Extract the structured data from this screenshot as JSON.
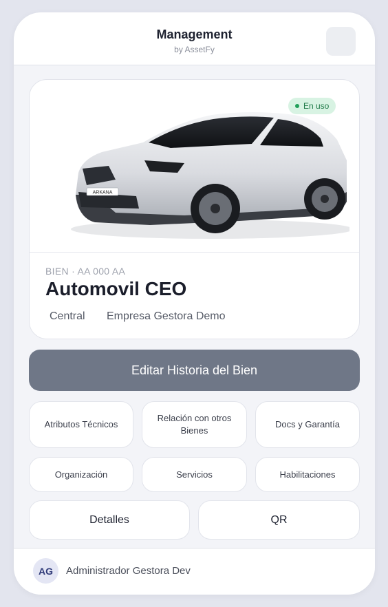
{
  "header": {
    "title": "Management",
    "subtitle": "by AssetFy"
  },
  "asset": {
    "status": "En uso",
    "code": "BIEN · AA 000 AA",
    "name": "Automovil CEO",
    "location": "Central",
    "company": "Empresa Gestora Demo",
    "plate": "ARKANA",
    "colors": {
      "status_bg": "#d8f3e3",
      "status_text": "#1f7a48"
    }
  },
  "actions": {
    "edit_label": "Editar Historia del Bien",
    "technical": "Atributos Técnicos",
    "relations": "Relación con otros Bienes",
    "docs": "Docs y Garantía",
    "organization": "Organización",
    "services": "Servicios",
    "permits": "Habilitaciones",
    "details": "Detalles",
    "qr": "QR"
  },
  "user": {
    "initials": "AG",
    "name": "Administrador Gestora Dev"
  }
}
